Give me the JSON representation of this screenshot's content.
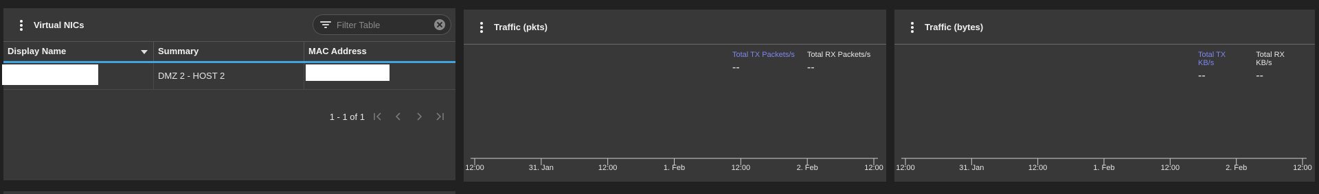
{
  "vnics_panel": {
    "title": "Virtual NICs",
    "filter_placeholder": "Filter Table",
    "columns": [
      "Display Name",
      "Summary",
      "MAC Address"
    ],
    "rows": [
      {
        "display_name": "",
        "summary": "DMZ 2 - HOST 2",
        "mac_address": ""
      }
    ],
    "pagination_text": "1 - 1 of 1"
  },
  "traffic_pkts": {
    "title": "Traffic (pkts)",
    "legend": [
      {
        "label": "Total TX Packets/s",
        "value": "--",
        "color": "#7f86f0"
      },
      {
        "label": "Total RX Packets/s",
        "value": "--",
        "color": "#e6e6e6"
      }
    ],
    "x_ticks": [
      "12:00",
      "31. Jan",
      "12:00",
      "1. Feb",
      "12:00",
      "2. Feb",
      "12:00"
    ]
  },
  "traffic_bytes": {
    "title": "Traffic (bytes)",
    "legend": [
      {
        "label": "Total TX KB/s",
        "value": "--",
        "color": "#7f86f0"
      },
      {
        "label": "Total RX KB/s",
        "value": "--",
        "color": "#e6e6e6"
      }
    ],
    "x_ticks": [
      "12:00",
      "31. Jan",
      "12:00",
      "1. Feb",
      "12:00",
      "2. Feb",
      "12:00"
    ]
  },
  "colors": {
    "background": "#212121",
    "panel": "#383838",
    "accent": "#3fa7e0",
    "tx_series": "#7f86f0"
  }
}
